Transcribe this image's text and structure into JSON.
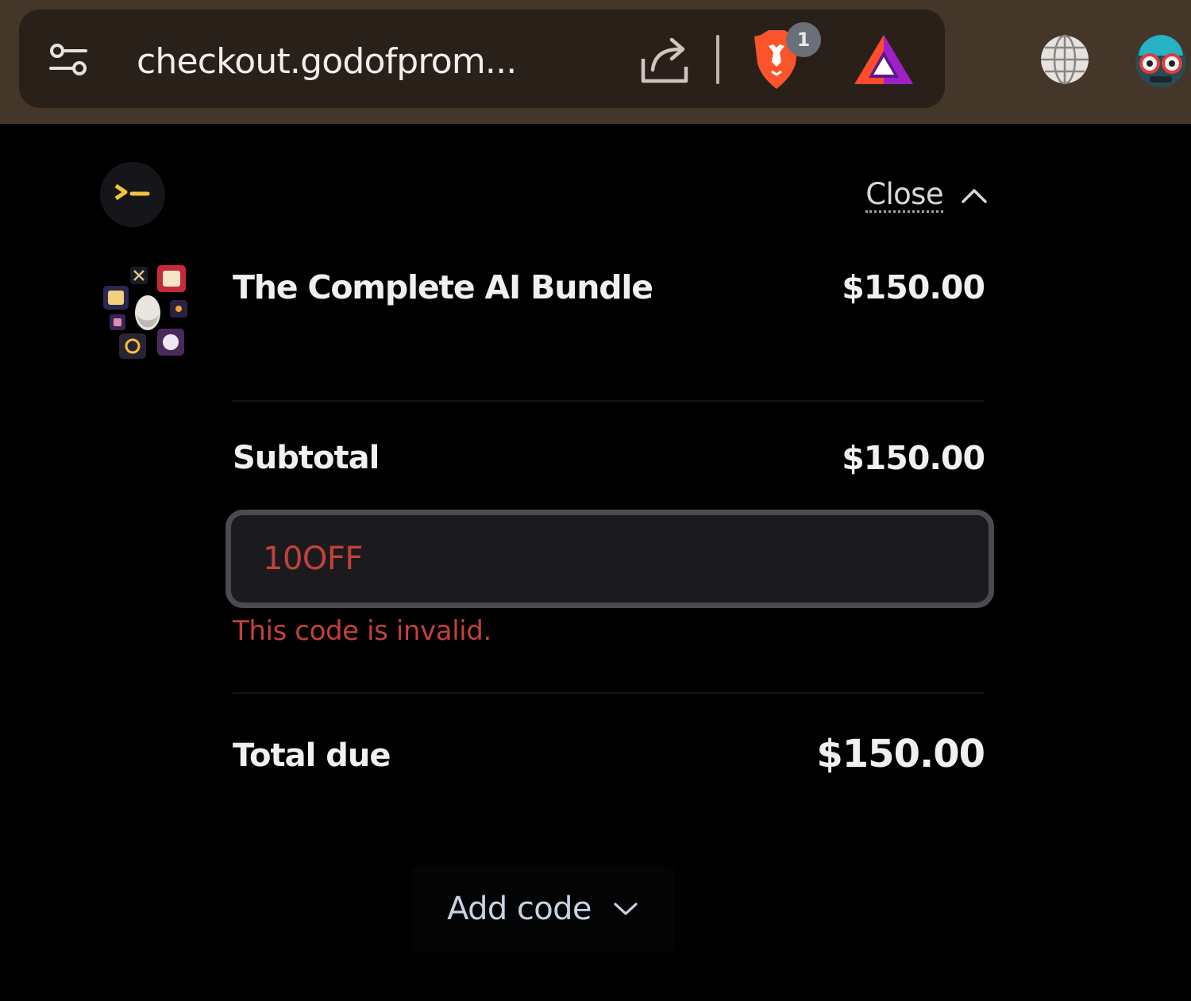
{
  "browser": {
    "url_display": "checkout.godofprom...",
    "shields_badge_count": "1",
    "icons": [
      "site-settings-icon",
      "share-icon",
      "brave-shields-icon",
      "brave-rewards-icon",
      "vpn-globe-icon",
      "profile-avatar-icon"
    ]
  },
  "summary": {
    "close_label": "Close",
    "product": {
      "name": "The Complete AI Bundle",
      "price": "$150.00"
    },
    "subtotal": {
      "label": "Subtotal",
      "amount": "$150.00"
    },
    "promo": {
      "value": "10OFF",
      "error": "This code is invalid."
    },
    "total": {
      "label": "Total due",
      "amount": "$150.00"
    },
    "add_code_label": "Add code"
  },
  "colors": {
    "chrome_bar": "#45362a",
    "url_pill": "#2a201a",
    "page_background": "#000000",
    "error_red": "#c2413b",
    "logo_accent": "#f2c23a",
    "link_blue_gray": "#c7d3e2"
  }
}
